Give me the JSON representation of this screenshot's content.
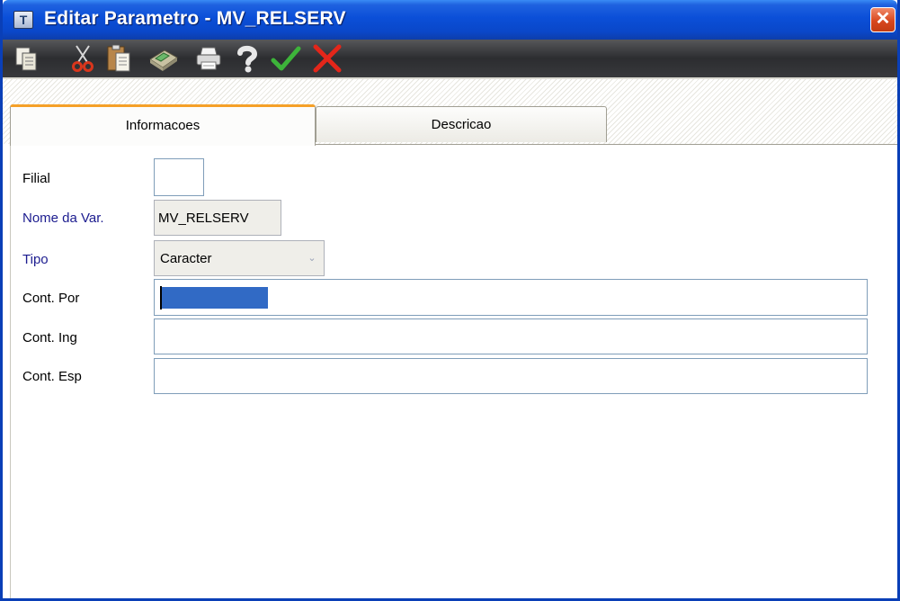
{
  "window": {
    "title": "Editar Parametro - MV_RELSERV",
    "app_icon_glyph": "T",
    "close_glyph": "✕"
  },
  "toolbar": {
    "buttons": [
      {
        "name": "copy-icon"
      },
      {
        "name": "cut-icon"
      },
      {
        "name": "paste-icon"
      },
      {
        "name": "calculator-icon"
      },
      {
        "name": "print-icon"
      },
      {
        "name": "help-icon"
      },
      {
        "name": "confirm-icon"
      },
      {
        "name": "cancel-icon"
      }
    ]
  },
  "tabs": [
    {
      "label": "Informacoes",
      "active": true
    },
    {
      "label": "Descricao",
      "active": false
    }
  ],
  "form": {
    "filial": {
      "label": "Filial",
      "value": ""
    },
    "nome_var": {
      "label": "Nome da Var.",
      "value": "MV_RELSERV"
    },
    "tipo": {
      "label": "Tipo",
      "value": "Caracter"
    },
    "cont_por": {
      "label": "Cont. Por",
      "value": ""
    },
    "cont_ing": {
      "label": "Cont. Ing",
      "value": ""
    },
    "cont_esp": {
      "label": "Cont. Esp",
      "value": ""
    }
  },
  "colors": {
    "titlebar": "#0a47c9",
    "label_blue": "#1c1c8f",
    "tab_accent": "#f5a028",
    "selection": "#316ac5"
  }
}
